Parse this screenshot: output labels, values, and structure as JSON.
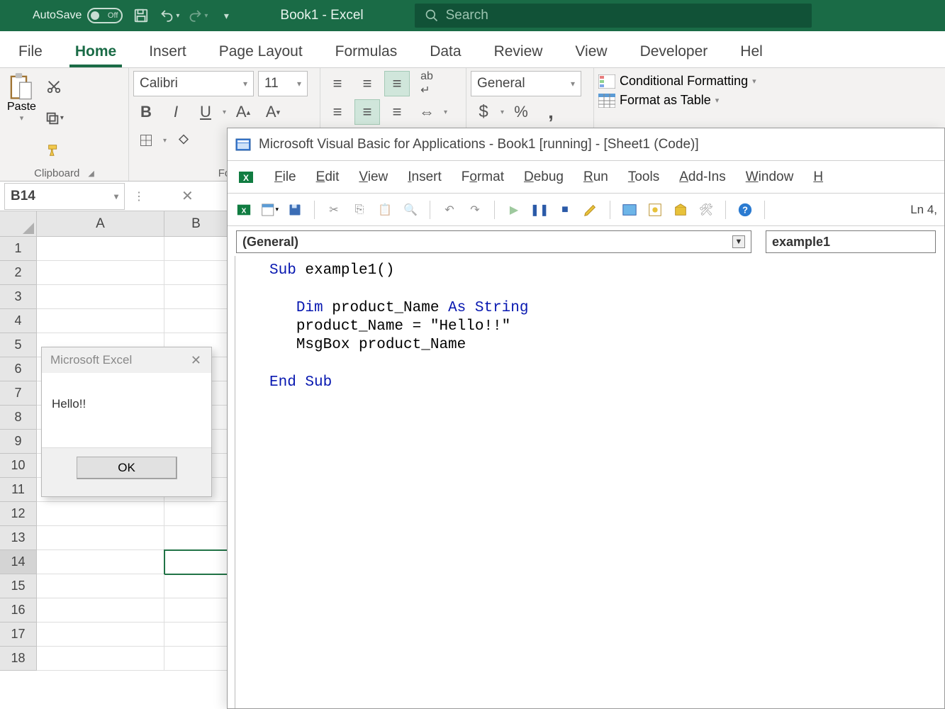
{
  "titlebar": {
    "autosave_label": "AutoSave",
    "autosave_state": "Off",
    "doc_title": "Book1 - Excel",
    "search_placeholder": "Search"
  },
  "ribbon": {
    "tabs": [
      "File",
      "Home",
      "Insert",
      "Page Layout",
      "Formulas",
      "Data",
      "Review",
      "View",
      "Developer",
      "Hel"
    ],
    "active_tab": "Home",
    "clipboard_label": "Clipboard",
    "paste_label": "Paste",
    "font_name": "Calibri",
    "font_size": "11",
    "font_group_label": "Fo",
    "number_format": "General",
    "cond_fmt_label": "Conditional Formatting",
    "fmt_table_label": "Format as Table"
  },
  "namebox": {
    "ref": "B14"
  },
  "grid": {
    "columns": [
      "A",
      "B"
    ],
    "rows": [
      "1",
      "2",
      "3",
      "4",
      "5",
      "6",
      "7",
      "8",
      "9",
      "10",
      "11",
      "12",
      "13",
      "14",
      "15",
      "16",
      "17",
      "18"
    ],
    "selected": "B14"
  },
  "msgbox": {
    "title": "Microsoft Excel",
    "text": "Hello!!",
    "ok": "OK"
  },
  "vba": {
    "title": "Microsoft Visual Basic for Applications - Book1 [running] - [Sheet1 (Code)]",
    "menu": [
      "File",
      "Edit",
      "View",
      "Insert",
      "Format",
      "Debug",
      "Run",
      "Tools",
      "Add-Ins",
      "Window",
      "H"
    ],
    "ln_status": "Ln 4,",
    "object_combo": "(General)",
    "proc_combo": "example1",
    "code": {
      "l1a": "Sub ",
      "l1b": "example1()",
      "l2a": "Dim ",
      "l2b": "product_Name ",
      "l2c": "As String",
      "l3": "product_Name = \"Hello!!\"",
      "l4": "MsgBox product_Name",
      "l5": "End Sub"
    }
  }
}
